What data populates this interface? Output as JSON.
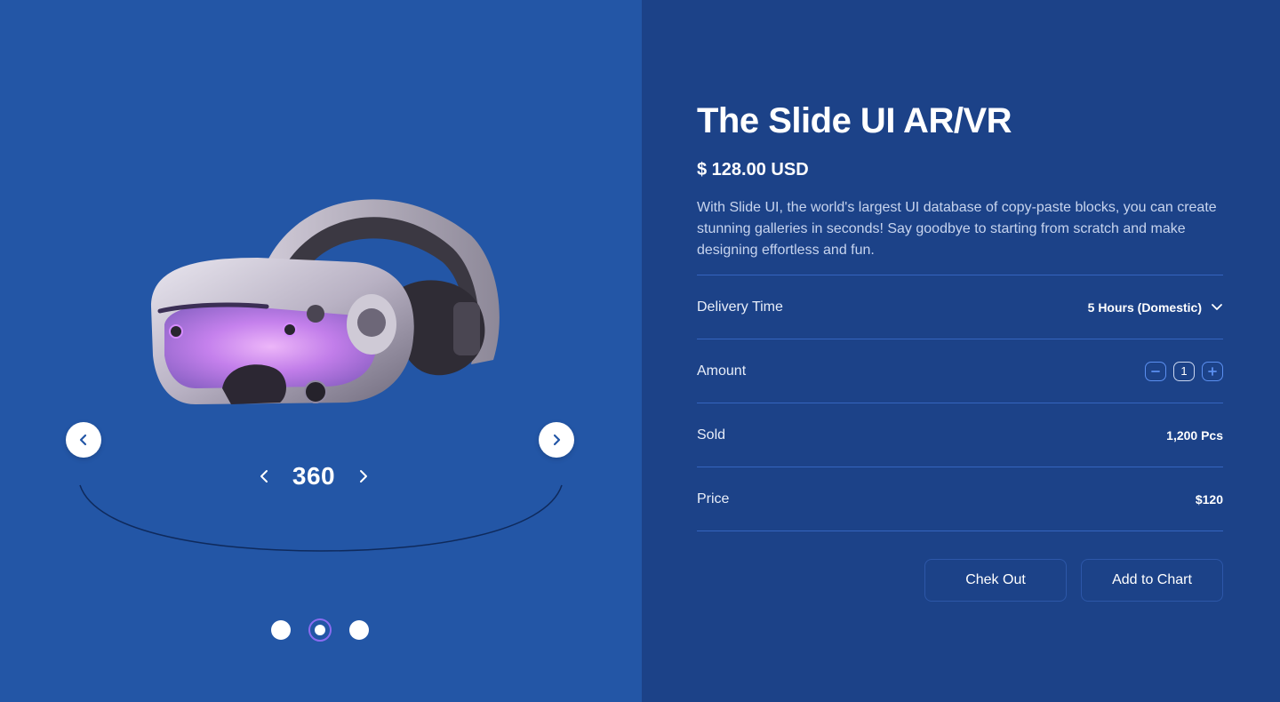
{
  "gallery": {
    "rotate_label": "360",
    "active_slide": 2,
    "slide_count": 3
  },
  "product": {
    "title": "The Slide UI AR/VR",
    "price": "$ 128.00 USD",
    "description": "With Slide UI, the world's largest UI database of copy-paste blocks, you can create stunning galleries in seconds! Say goodbye to starting from scratch and make designing effortless and fun."
  },
  "details": {
    "delivery": {
      "label": "Delivery Time",
      "value": "5 Hours (Domestic)"
    },
    "amount": {
      "label": "Amount",
      "value": "1"
    },
    "sold": {
      "label": "Sold",
      "value": "1,200 Pcs"
    },
    "price": {
      "label": "Price",
      "value": "$120"
    }
  },
  "actions": {
    "checkout_label": "Chek Out",
    "add_label": "Add to Chart"
  },
  "colors": {
    "left_bg": "#2356a6",
    "right_bg": "#1c4288",
    "accent_border": "#5b8ff0",
    "active_dot_ring": "#8a6cf0"
  }
}
